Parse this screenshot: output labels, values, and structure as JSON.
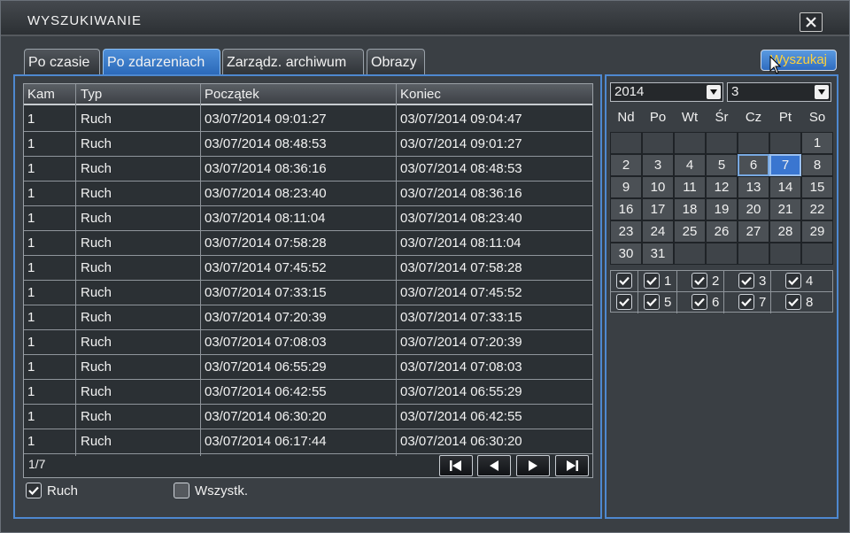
{
  "window": {
    "title": "WYSZUKIWANIE"
  },
  "tabs": [
    {
      "label": "Po czasie"
    },
    {
      "label": "Po zdarzeniach",
      "active": true
    },
    {
      "label": "Zarządz. archiwum"
    },
    {
      "label": "Obrazy"
    }
  ],
  "search_button": "Wyszukaj",
  "table": {
    "headers": [
      "Kam",
      "Typ",
      "Początek",
      "Koniec"
    ],
    "rows": [
      [
        "1",
        "Ruch",
        "03/07/2014 09:01:27",
        "03/07/2014 09:04:47"
      ],
      [
        "1",
        "Ruch",
        "03/07/2014 08:48:53",
        "03/07/2014 09:01:27"
      ],
      [
        "1",
        "Ruch",
        "03/07/2014 08:36:16",
        "03/07/2014 08:48:53"
      ],
      [
        "1",
        "Ruch",
        "03/07/2014 08:23:40",
        "03/07/2014 08:36:16"
      ],
      [
        "1",
        "Ruch",
        "03/07/2014 08:11:04",
        "03/07/2014 08:23:40"
      ],
      [
        "1",
        "Ruch",
        "03/07/2014 07:58:28",
        "03/07/2014 08:11:04"
      ],
      [
        "1",
        "Ruch",
        "03/07/2014 07:45:52",
        "03/07/2014 07:58:28"
      ],
      [
        "1",
        "Ruch",
        "03/07/2014 07:33:15",
        "03/07/2014 07:45:52"
      ],
      [
        "1",
        "Ruch",
        "03/07/2014 07:20:39",
        "03/07/2014 07:33:15"
      ],
      [
        "1",
        "Ruch",
        "03/07/2014 07:08:03",
        "03/07/2014 07:20:39"
      ],
      [
        "1",
        "Ruch",
        "03/07/2014 06:55:29",
        "03/07/2014 07:08:03"
      ],
      [
        "1",
        "Ruch",
        "03/07/2014 06:42:55",
        "03/07/2014 06:55:29"
      ],
      [
        "1",
        "Ruch",
        "03/07/2014 06:30:20",
        "03/07/2014 06:42:55"
      ],
      [
        "1",
        "Ruch",
        "03/07/2014 06:17:44",
        "03/07/2014 06:30:20"
      ]
    ],
    "page": "1/7"
  },
  "filters": {
    "motion_label": "Ruch",
    "motion_checked": true,
    "all_label": "Wszystk.",
    "all_checked": false
  },
  "calendar": {
    "year": "2014",
    "month": "3",
    "weekdays": [
      "Nd",
      "Po",
      "Wt",
      "Śr",
      "Cz",
      "Pt",
      "So"
    ],
    "first_weekday_index": 6,
    "days_in_month": 31,
    "highlighted_days": [
      6
    ],
    "selected_day": 7
  },
  "channels": {
    "labels": [
      "1",
      "2",
      "3",
      "4",
      "5",
      "6",
      "7",
      "8"
    ],
    "all_checked": true
  },
  "colors": {
    "panel_border": "#4e88d0",
    "active_tab": "#2a68b8",
    "search_text": "#ffd23a"
  }
}
